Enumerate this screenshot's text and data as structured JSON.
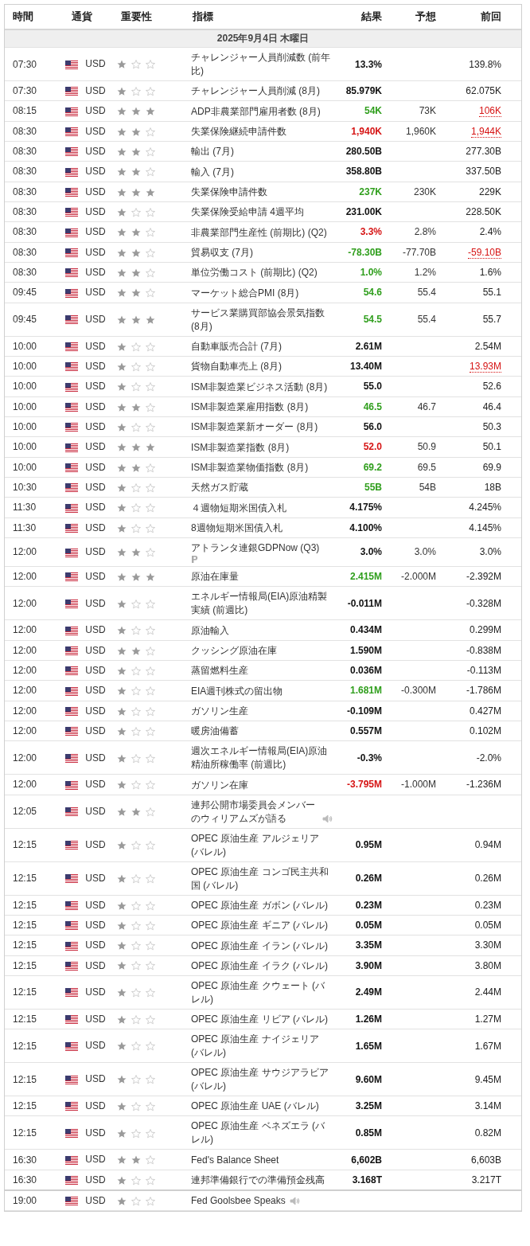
{
  "columns": [
    "時間",
    "通貨",
    "重要性",
    "指標",
    "結果",
    "予想",
    "前回"
  ],
  "date": "2025年9月4日 木曜日",
  "rows": [
    {
      "time": "07:30",
      "currency": "USD",
      "stars": 1,
      "name": "チャレンジャー人員削減数 (前年比)",
      "actual": "13.3%",
      "actual_better": false,
      "actual_worse": false,
      "forecast": "",
      "previous": "139.8%",
      "previous_revised": false,
      "speech": false,
      "preliminary": false
    },
    {
      "time": "07:30",
      "currency": "USD",
      "stars": 1,
      "name": "チャレンジャー人員削減 (8月)",
      "actual": "85.979K",
      "actual_better": false,
      "actual_worse": false,
      "forecast": "",
      "previous": "62.075K",
      "previous_revised": false,
      "speech": false,
      "preliminary": false
    },
    {
      "time": "08:15",
      "currency": "USD",
      "stars": 3,
      "name": "ADP非農業部門雇用者数 (8月)",
      "actual": "54K",
      "actual_better": true,
      "actual_worse": false,
      "forecast": "73K",
      "previous": "106K",
      "previous_revised": true,
      "speech": false,
      "preliminary": false
    },
    {
      "time": "08:30",
      "currency": "USD",
      "stars": 2,
      "name": "失業保険継続申請件数",
      "actual": "1,940K",
      "actual_better": false,
      "actual_worse": true,
      "forecast": "1,960K",
      "previous": "1,944K",
      "previous_revised": true,
      "speech": false,
      "preliminary": false
    },
    {
      "time": "08:30",
      "currency": "USD",
      "stars": 2,
      "name": "輸出 (7月)",
      "actual": "280.50B",
      "actual_better": false,
      "actual_worse": false,
      "forecast": "",
      "previous": "277.30B",
      "previous_revised": false,
      "speech": false,
      "preliminary": false
    },
    {
      "time": "08:30",
      "currency": "USD",
      "stars": 2,
      "name": "輸入 (7月)",
      "actual": "358.80B",
      "actual_better": false,
      "actual_worse": false,
      "forecast": "",
      "previous": "337.50B",
      "previous_revised": false,
      "speech": false,
      "preliminary": false
    },
    {
      "time": "08:30",
      "currency": "USD",
      "stars": 3,
      "name": "失業保険申請件数",
      "actual": "237K",
      "actual_better": true,
      "actual_worse": false,
      "forecast": "230K",
      "previous": "229K",
      "previous_revised": false,
      "speech": false,
      "preliminary": false
    },
    {
      "time": "08:30",
      "currency": "USD",
      "stars": 1,
      "name": "失業保険受給申請 4週平均",
      "actual": "231.00K",
      "actual_better": false,
      "actual_worse": false,
      "forecast": "",
      "previous": "228.50K",
      "previous_revised": false,
      "speech": false,
      "preliminary": false
    },
    {
      "time": "08:30",
      "currency": "USD",
      "stars": 2,
      "name": "非農業部門生産性 (前期比) (Q2)",
      "actual": "3.3%",
      "actual_better": false,
      "actual_worse": true,
      "forecast": "2.8%",
      "previous": "2.4%",
      "previous_revised": false,
      "speech": false,
      "preliminary": false
    },
    {
      "time": "08:30",
      "currency": "USD",
      "stars": 2,
      "name": "貿易収支 (7月)",
      "actual": "-78.30B",
      "actual_better": true,
      "actual_worse": false,
      "forecast": "-77.70B",
      "previous": "-59.10B",
      "previous_revised": true,
      "speech": false,
      "preliminary": false
    },
    {
      "time": "08:30",
      "currency": "USD",
      "stars": 2,
      "name": "単位労働コスト (前期比) (Q2)",
      "actual": "1.0%",
      "actual_better": true,
      "actual_worse": false,
      "forecast": "1.2%",
      "previous": "1.6%",
      "previous_revised": false,
      "speech": false,
      "preliminary": false
    },
    {
      "time": "09:45",
      "currency": "USD",
      "stars": 2,
      "name": "マーケット総合PMI (8月)",
      "actual": "54.6",
      "actual_better": true,
      "actual_worse": false,
      "forecast": "55.4",
      "previous": "55.1",
      "previous_revised": false,
      "speech": false,
      "preliminary": false
    },
    {
      "time": "09:45",
      "currency": "USD",
      "stars": 3,
      "name": "サービス業購買部協会景気指数 (8月)",
      "actual": "54.5",
      "actual_better": true,
      "actual_worse": false,
      "forecast": "55.4",
      "previous": "55.7",
      "previous_revised": false,
      "speech": false,
      "preliminary": false
    },
    {
      "time": "10:00",
      "currency": "USD",
      "stars": 1,
      "name": "自動車販売合計 (7月)",
      "actual": "2.61M",
      "actual_better": false,
      "actual_worse": false,
      "forecast": "",
      "previous": "2.54M",
      "previous_revised": false,
      "speech": false,
      "preliminary": false
    },
    {
      "time": "10:00",
      "currency": "USD",
      "stars": 1,
      "name": "貨物自動車売上 (8月)",
      "actual": "13.40M",
      "actual_better": false,
      "actual_worse": false,
      "forecast": "",
      "previous": "13.93M",
      "previous_revised": true,
      "speech": false,
      "preliminary": false
    },
    {
      "time": "10:00",
      "currency": "USD",
      "stars": 1,
      "name": "ISM非製造業ビジネス活動 (8月)",
      "actual": "55.0",
      "actual_better": false,
      "actual_worse": false,
      "forecast": "",
      "previous": "52.6",
      "previous_revised": false,
      "speech": false,
      "preliminary": false
    },
    {
      "time": "10:00",
      "currency": "USD",
      "stars": 2,
      "name": "ISM非製造業雇用指数 (8月)",
      "actual": "46.5",
      "actual_better": true,
      "actual_worse": false,
      "forecast": "46.7",
      "previous": "46.4",
      "previous_revised": false,
      "speech": false,
      "preliminary": false
    },
    {
      "time": "10:00",
      "currency": "USD",
      "stars": 1,
      "name": "ISM非製造業新オーダー (8月)",
      "actual": "56.0",
      "actual_better": false,
      "actual_worse": false,
      "forecast": "",
      "previous": "50.3",
      "previous_revised": false,
      "speech": false,
      "preliminary": false
    },
    {
      "time": "10:00",
      "currency": "USD",
      "stars": 3,
      "name": "ISM非製造業指数 (8月)",
      "actual": "52.0",
      "actual_better": false,
      "actual_worse": true,
      "forecast": "50.9",
      "previous": "50.1",
      "previous_revised": false,
      "speech": false,
      "preliminary": false
    },
    {
      "time": "10:00",
      "currency": "USD",
      "stars": 2,
      "name": "ISM非製造業物価指数 (8月)",
      "actual": "69.2",
      "actual_better": true,
      "actual_worse": false,
      "forecast": "69.5",
      "previous": "69.9",
      "previous_revised": false,
      "speech": false,
      "preliminary": false
    },
    {
      "time": "10:30",
      "currency": "USD",
      "stars": 1,
      "name": "天然ガス貯蔵",
      "actual": "55B",
      "actual_better": true,
      "actual_worse": false,
      "forecast": "54B",
      "previous": "18B",
      "previous_revised": false,
      "speech": false,
      "preliminary": false
    },
    {
      "time": "11:30",
      "currency": "USD",
      "stars": 1,
      "name": "４週物短期米国債入札",
      "actual": "4.175%",
      "actual_better": false,
      "actual_worse": false,
      "forecast": "",
      "previous": "4.245%",
      "previous_revised": false,
      "speech": false,
      "preliminary": false
    },
    {
      "time": "11:30",
      "currency": "USD",
      "stars": 1,
      "name": "8週物短期米国債入札",
      "actual": "4.100%",
      "actual_better": false,
      "actual_worse": false,
      "forecast": "",
      "previous": "4.145%",
      "previous_revised": false,
      "speech": false,
      "preliminary": false
    },
    {
      "time": "12:00",
      "currency": "USD",
      "stars": 2,
      "name": "アトランタ連銀GDPNow (Q3)",
      "actual": "3.0%",
      "actual_better": false,
      "actual_worse": false,
      "forecast": "3.0%",
      "previous": "3.0%",
      "previous_revised": false,
      "speech": false,
      "preliminary": true
    },
    {
      "time": "12:00",
      "currency": "USD",
      "stars": 3,
      "name": "原油在庫量",
      "actual": "2.415M",
      "actual_better": true,
      "actual_worse": false,
      "forecast": "-2.000M",
      "previous": "-2.392M",
      "previous_revised": false,
      "speech": false,
      "preliminary": false
    },
    {
      "time": "12:00",
      "currency": "USD",
      "stars": 1,
      "name": "エネルギー情報局(EIA)原油精製実績 (前週比)",
      "actual": "-0.011M",
      "actual_better": false,
      "actual_worse": false,
      "forecast": "",
      "previous": "-0.328M",
      "previous_revised": false,
      "speech": false,
      "preliminary": false
    },
    {
      "time": "12:00",
      "currency": "USD",
      "stars": 1,
      "name": "原油輸入",
      "actual": "0.434M",
      "actual_better": false,
      "actual_worse": false,
      "forecast": "",
      "previous": "0.299M",
      "previous_revised": false,
      "speech": false,
      "preliminary": false
    },
    {
      "time": "12:00",
      "currency": "USD",
      "stars": 2,
      "name": "クッシング原油在庫",
      "actual": "1.590M",
      "actual_better": false,
      "actual_worse": false,
      "forecast": "",
      "previous": "-0.838M",
      "previous_revised": false,
      "speech": false,
      "preliminary": false
    },
    {
      "time": "12:00",
      "currency": "USD",
      "stars": 1,
      "name": "蒸留燃料生産",
      "actual": "0.036M",
      "actual_better": false,
      "actual_worse": false,
      "forecast": "",
      "previous": "-0.113M",
      "previous_revised": false,
      "speech": false,
      "preliminary": false
    },
    {
      "time": "12:00",
      "currency": "USD",
      "stars": 1,
      "name": "EIA週刊株式の留出物",
      "actual": "1.681M",
      "actual_better": true,
      "actual_worse": false,
      "forecast": "-0.300M",
      "previous": "-1.786M",
      "previous_revised": false,
      "speech": false,
      "preliminary": false
    },
    {
      "time": "12:00",
      "currency": "USD",
      "stars": 1,
      "name": "ガソリン生産",
      "actual": "-0.109M",
      "actual_better": false,
      "actual_worse": false,
      "forecast": "",
      "previous": "0.427M",
      "previous_revised": false,
      "speech": false,
      "preliminary": false
    },
    {
      "time": "12:00",
      "currency": "USD",
      "stars": 1,
      "name": "暖房油備蓄",
      "actual": "0.557M",
      "actual_better": false,
      "actual_worse": false,
      "forecast": "",
      "previous": "0.102M",
      "previous_revised": false,
      "speech": false,
      "preliminary": false
    },
    {
      "time": "12:00",
      "currency": "USD",
      "stars": 1,
      "name": "週次エネルギー情報局(EIA)原油精油所稼働率 (前週比)",
      "actual": "-0.3%",
      "actual_better": false,
      "actual_worse": false,
      "forecast": "",
      "previous": "-2.0%",
      "previous_revised": false,
      "speech": false,
      "preliminary": false
    },
    {
      "time": "12:00",
      "currency": "USD",
      "stars": 1,
      "name": "ガソリン在庫",
      "actual": "-3.795M",
      "actual_better": false,
      "actual_worse": true,
      "forecast": "-1.000M",
      "previous": "-1.236M",
      "previous_revised": false,
      "speech": false,
      "preliminary": false
    },
    {
      "time": "12:05",
      "currency": "USD",
      "stars": 2,
      "name": "連邦公開市場委員会メンバーのウィリアムズが語る",
      "speech": true,
      "preliminary": false
    },
    {
      "time": "12:15",
      "currency": "USD",
      "stars": 1,
      "name": "OPEC 原油生産 アルジェリア (バレル)",
      "actual": "0.95M",
      "actual_better": false,
      "actual_worse": false,
      "forecast": "",
      "previous": "0.94M",
      "previous_revised": false,
      "speech": false,
      "preliminary": false
    },
    {
      "time": "12:15",
      "currency": "USD",
      "stars": 1,
      "name": "OPEC 原油生産 コンゴ民主共和国 (バレル)",
      "actual": "0.26M",
      "actual_better": false,
      "actual_worse": false,
      "forecast": "",
      "previous": "0.26M",
      "previous_revised": false,
      "speech": false,
      "preliminary": false
    },
    {
      "time": "12:15",
      "currency": "USD",
      "stars": 1,
      "name": "OPEC 原油生産 ガボン (バレル)",
      "actual": "0.23M",
      "actual_better": false,
      "actual_worse": false,
      "forecast": "",
      "previous": "0.23M",
      "previous_revised": false,
      "speech": false,
      "preliminary": false
    },
    {
      "time": "12:15",
      "currency": "USD",
      "stars": 1,
      "name": "OPEC 原油生産 ギニア (バレル)",
      "actual": "0.05M",
      "actual_better": false,
      "actual_worse": false,
      "forecast": "",
      "previous": "0.05M",
      "previous_revised": false,
      "speech": false,
      "preliminary": false
    },
    {
      "time": "12:15",
      "currency": "USD",
      "stars": 1,
      "name": "OPEC 原油生産 イラン (バレル)",
      "actual": "3.35M",
      "actual_better": false,
      "actual_worse": false,
      "forecast": "",
      "previous": "3.30M",
      "previous_revised": false,
      "speech": false,
      "preliminary": false
    },
    {
      "time": "12:15",
      "currency": "USD",
      "stars": 1,
      "name": "OPEC 原油生産 イラク (バレル)",
      "actual": "3.90M",
      "actual_better": false,
      "actual_worse": false,
      "forecast": "",
      "previous": "3.80M",
      "previous_revised": false,
      "speech": false,
      "preliminary": false
    },
    {
      "time": "12:15",
      "currency": "USD",
      "stars": 1,
      "name": "OPEC 原油生産 クウェート (バレル)",
      "actual": "2.49M",
      "actual_better": false,
      "actual_worse": false,
      "forecast": "",
      "previous": "2.44M",
      "previous_revised": false,
      "speech": false,
      "preliminary": false
    },
    {
      "time": "12:15",
      "currency": "USD",
      "stars": 1,
      "name": "OPEC 原油生産 リビア (バレル)",
      "actual": "1.26M",
      "actual_better": false,
      "actual_worse": false,
      "forecast": "",
      "previous": "1.27M",
      "previous_revised": false,
      "speech": false,
      "preliminary": false
    },
    {
      "time": "12:15",
      "currency": "USD",
      "stars": 1,
      "name": "OPEC 原油生産 ナイジェリア (バレル)",
      "actual": "1.65M",
      "actual_better": false,
      "actual_worse": false,
      "forecast": "",
      "previous": "1.67M",
      "previous_revised": false,
      "speech": false,
      "preliminary": false
    },
    {
      "time": "12:15",
      "currency": "USD",
      "stars": 1,
      "name": "OPEC 原油生産 サウジアラビア (バレル)",
      "actual": "9.60M",
      "actual_better": false,
      "actual_worse": false,
      "forecast": "",
      "previous": "9.45M",
      "previous_revised": false,
      "speech": false,
      "preliminary": false
    },
    {
      "time": "12:15",
      "currency": "USD",
      "stars": 1,
      "name": "OPEC 原油生産 UAE (バレル)",
      "actual": "3.25M",
      "actual_better": false,
      "actual_worse": false,
      "forecast": "",
      "previous": "3.14M",
      "previous_revised": false,
      "speech": false,
      "preliminary": false
    },
    {
      "time": "12:15",
      "currency": "USD",
      "stars": 1,
      "name": "OPEC 原油生産 ベネズエラ (バレル)",
      "actual": "0.85M",
      "actual_better": false,
      "actual_worse": false,
      "forecast": "",
      "previous": "0.82M",
      "previous_revised": false,
      "speech": false,
      "preliminary": false
    },
    {
      "time": "16:30",
      "currency": "USD",
      "stars": 2,
      "name": "Fed's Balance Sheet",
      "actual": "6,602B",
      "actual_better": false,
      "actual_worse": false,
      "forecast": "",
      "previous": "6,603B",
      "previous_revised": false,
      "speech": false,
      "preliminary": false
    },
    {
      "time": "16:30",
      "currency": "USD",
      "stars": 1,
      "name": "連邦準備銀行での準備預金残高",
      "actual": "3.168T",
      "actual_better": false,
      "actual_worse": false,
      "forecast": "",
      "previous": "3.217T",
      "previous_revised": false,
      "speech": false,
      "preliminary": false
    }
  ],
  "upcoming_rows": [
    {
      "time": "19:00",
      "currency": "USD",
      "stars": 1,
      "name": "Fed Goolsbee Speaks",
      "speech": true,
      "preliminary": false
    }
  ]
}
